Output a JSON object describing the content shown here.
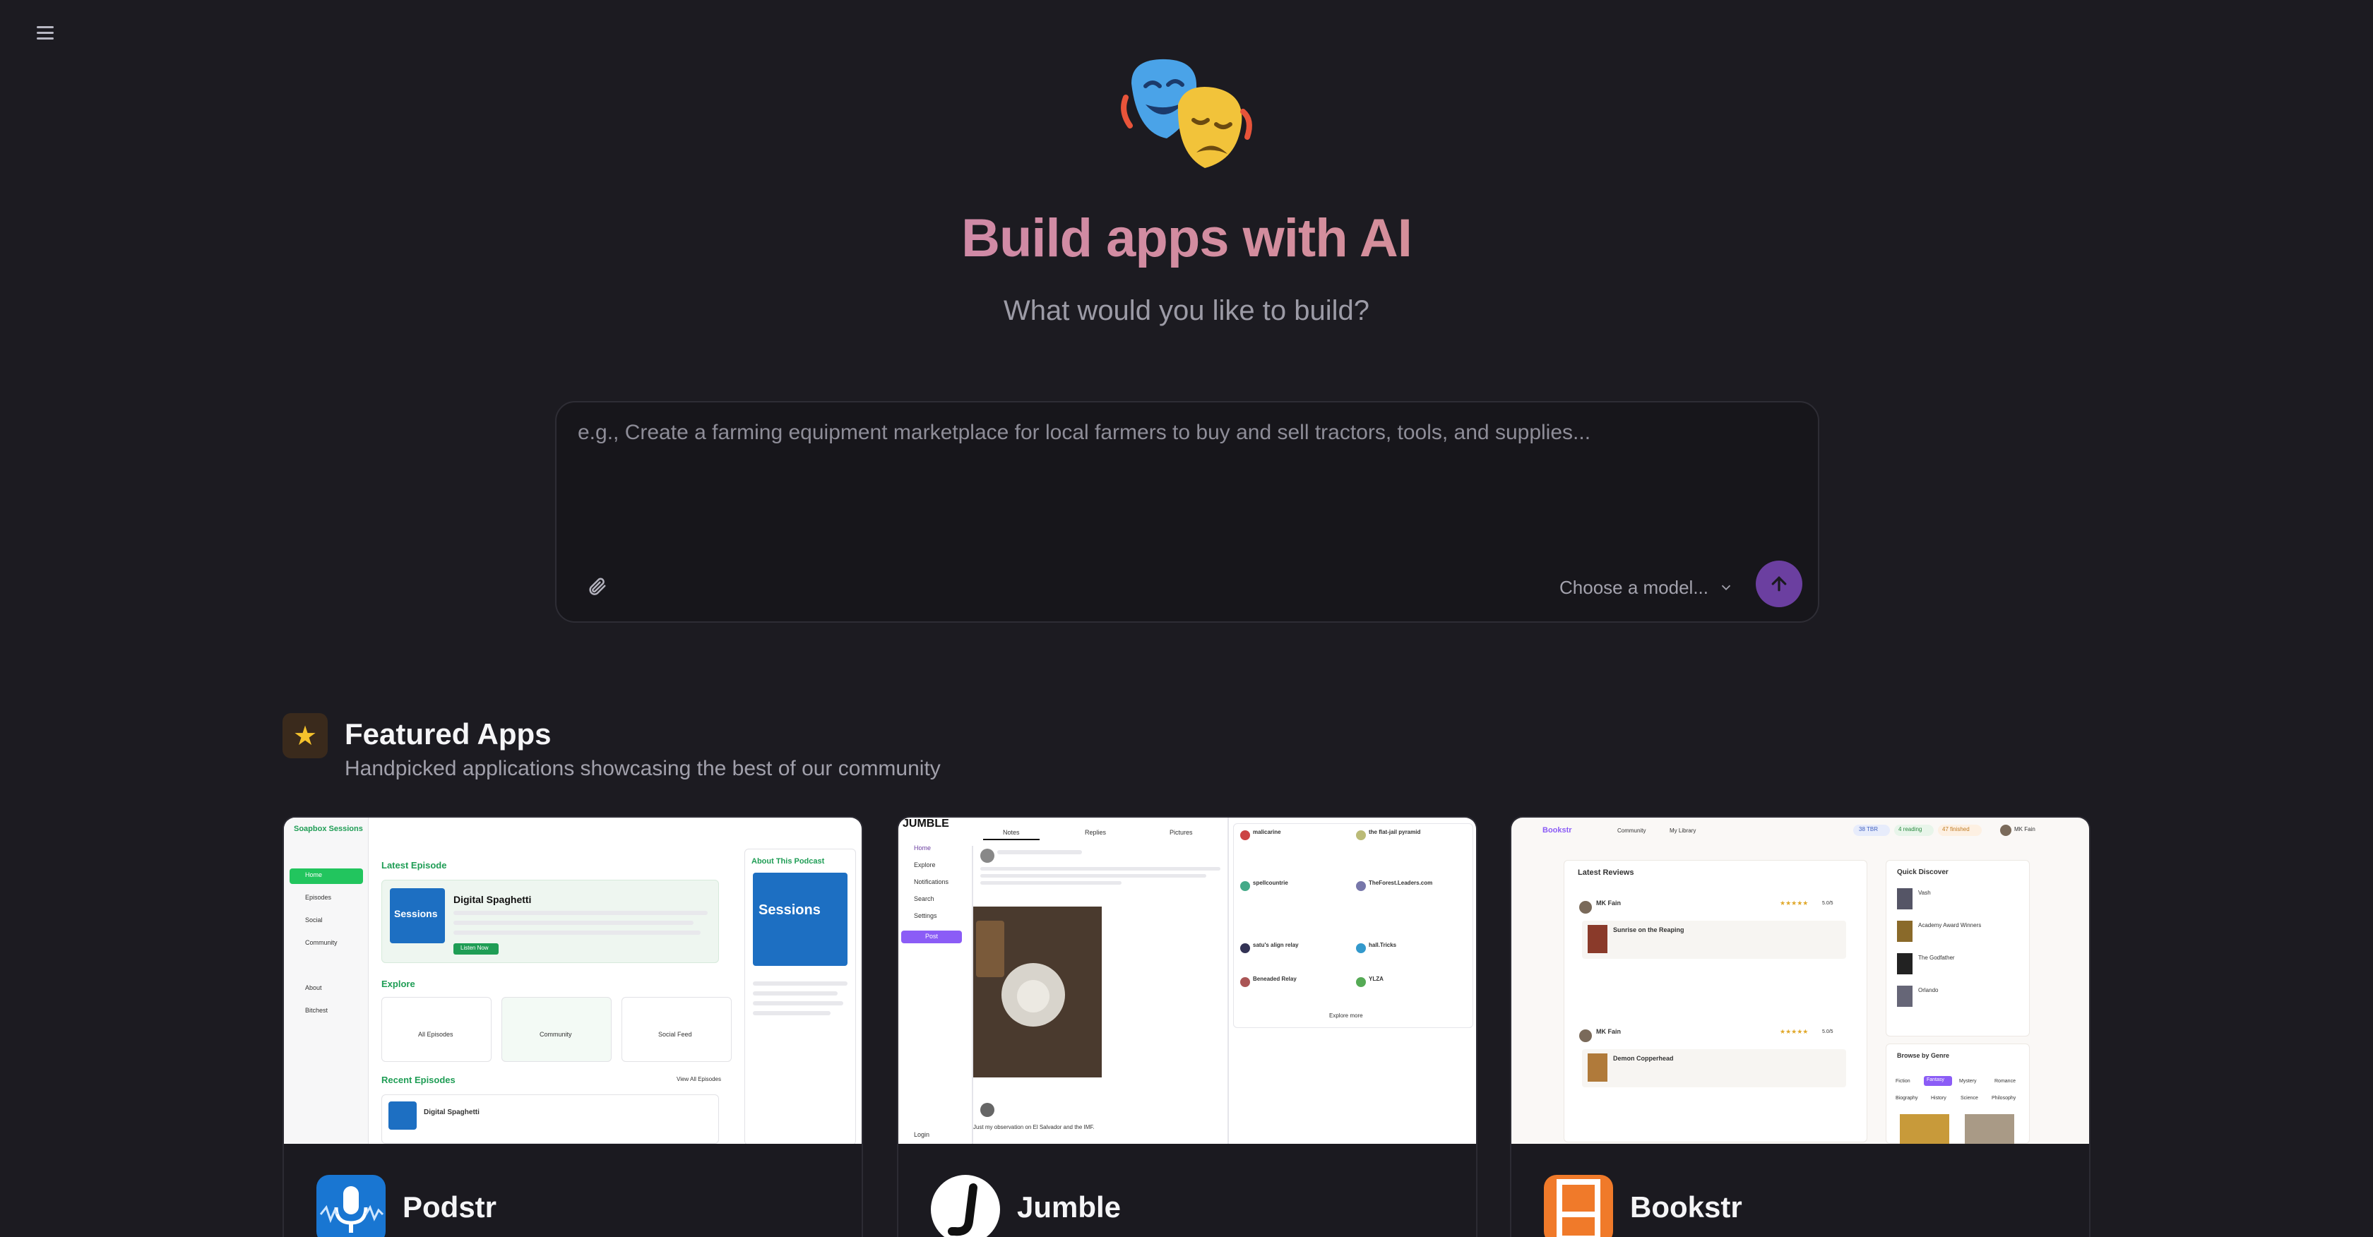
{
  "hero": {
    "title": "Build apps with AI",
    "subtitle": "What would you like to build?",
    "mask_icon": "performing-arts-masks-icon"
  },
  "prompt": {
    "placeholder": "e.g., Create a farming equipment marketplace for local farmers to buy and sell tractors, tools, and supplies...",
    "model_label": "Choose a model...",
    "attach_icon": "paperclip-icon",
    "send_icon": "arrow-up-icon",
    "send_color": "#6b3fa0"
  },
  "featured": {
    "title": "Featured Apps",
    "subtitle": "Handpicked applications showcasing the best of our community",
    "icon": "star-icon"
  },
  "apps": [
    {
      "name": "Podstr",
      "icon": "microphone-icon",
      "brand": "Soapbox Sessions",
      "heading": "Latest Episode",
      "episode_title": "Digital Spaghetti",
      "episode_badge": "Sessions",
      "explore": "Explore",
      "recent": "Recent Episodes",
      "about": "About This Podcast",
      "nav": [
        "Home",
        "Episodes",
        "Social",
        "Community",
        "About",
        "Bitchest"
      ],
      "tiles": [
        "All Episodes",
        "Community",
        "Social Feed"
      ],
      "listen_label": "Listen Now",
      "view_all": "View All Episodes",
      "recent_item": "Digital Spaghetti"
    },
    {
      "name": "Jumble",
      "icon": "jumble-j-icon",
      "logo": "JUMBLE",
      "tabs": [
        "Notes",
        "Replies",
        "Pictures"
      ],
      "nav": [
        "Home",
        "Explore",
        "Notifications",
        "Search",
        "Settings"
      ],
      "post_label": "Post",
      "login_label": "Login",
      "post_line": "Just my observation on El Salvador and the IMF.",
      "explore_more": "Explore more",
      "follow_users": [
        "malicarine",
        "the flat-jail pyramid",
        "spellcountrie",
        "TheForest.Leaders.com",
        "satu's align relay",
        "hall.Tricks",
        "Beneaded Relay",
        "YLZA"
      ]
    },
    {
      "name": "Bookstr",
      "icon": "bookshelf-icon",
      "brand": "Bookstr",
      "nav": [
        "Community",
        "My Library"
      ],
      "stats": [
        "38 TBR",
        "4 reading",
        "47 finished"
      ],
      "user": "MK Fain",
      "latest_reviews": "Latest Reviews",
      "quick_discover": "Quick Discover",
      "browse_genre": "Browse by Genre",
      "reviews": [
        {
          "user": "MK Fain",
          "book": "Sunrise on the Reaping",
          "rating": "5.0/5"
        },
        {
          "user": "MK Fain",
          "book": "Demon Copperhead",
          "rating": "5.0/5"
        }
      ],
      "discover": [
        "Vash",
        "Academy Award Winners",
        "The Godfather",
        "Orlando"
      ],
      "genres": [
        "Fiction",
        "Fantasy",
        "Mystery",
        "Romance",
        "Biography",
        "History",
        "Science",
        "Philosophy"
      ]
    }
  ]
}
